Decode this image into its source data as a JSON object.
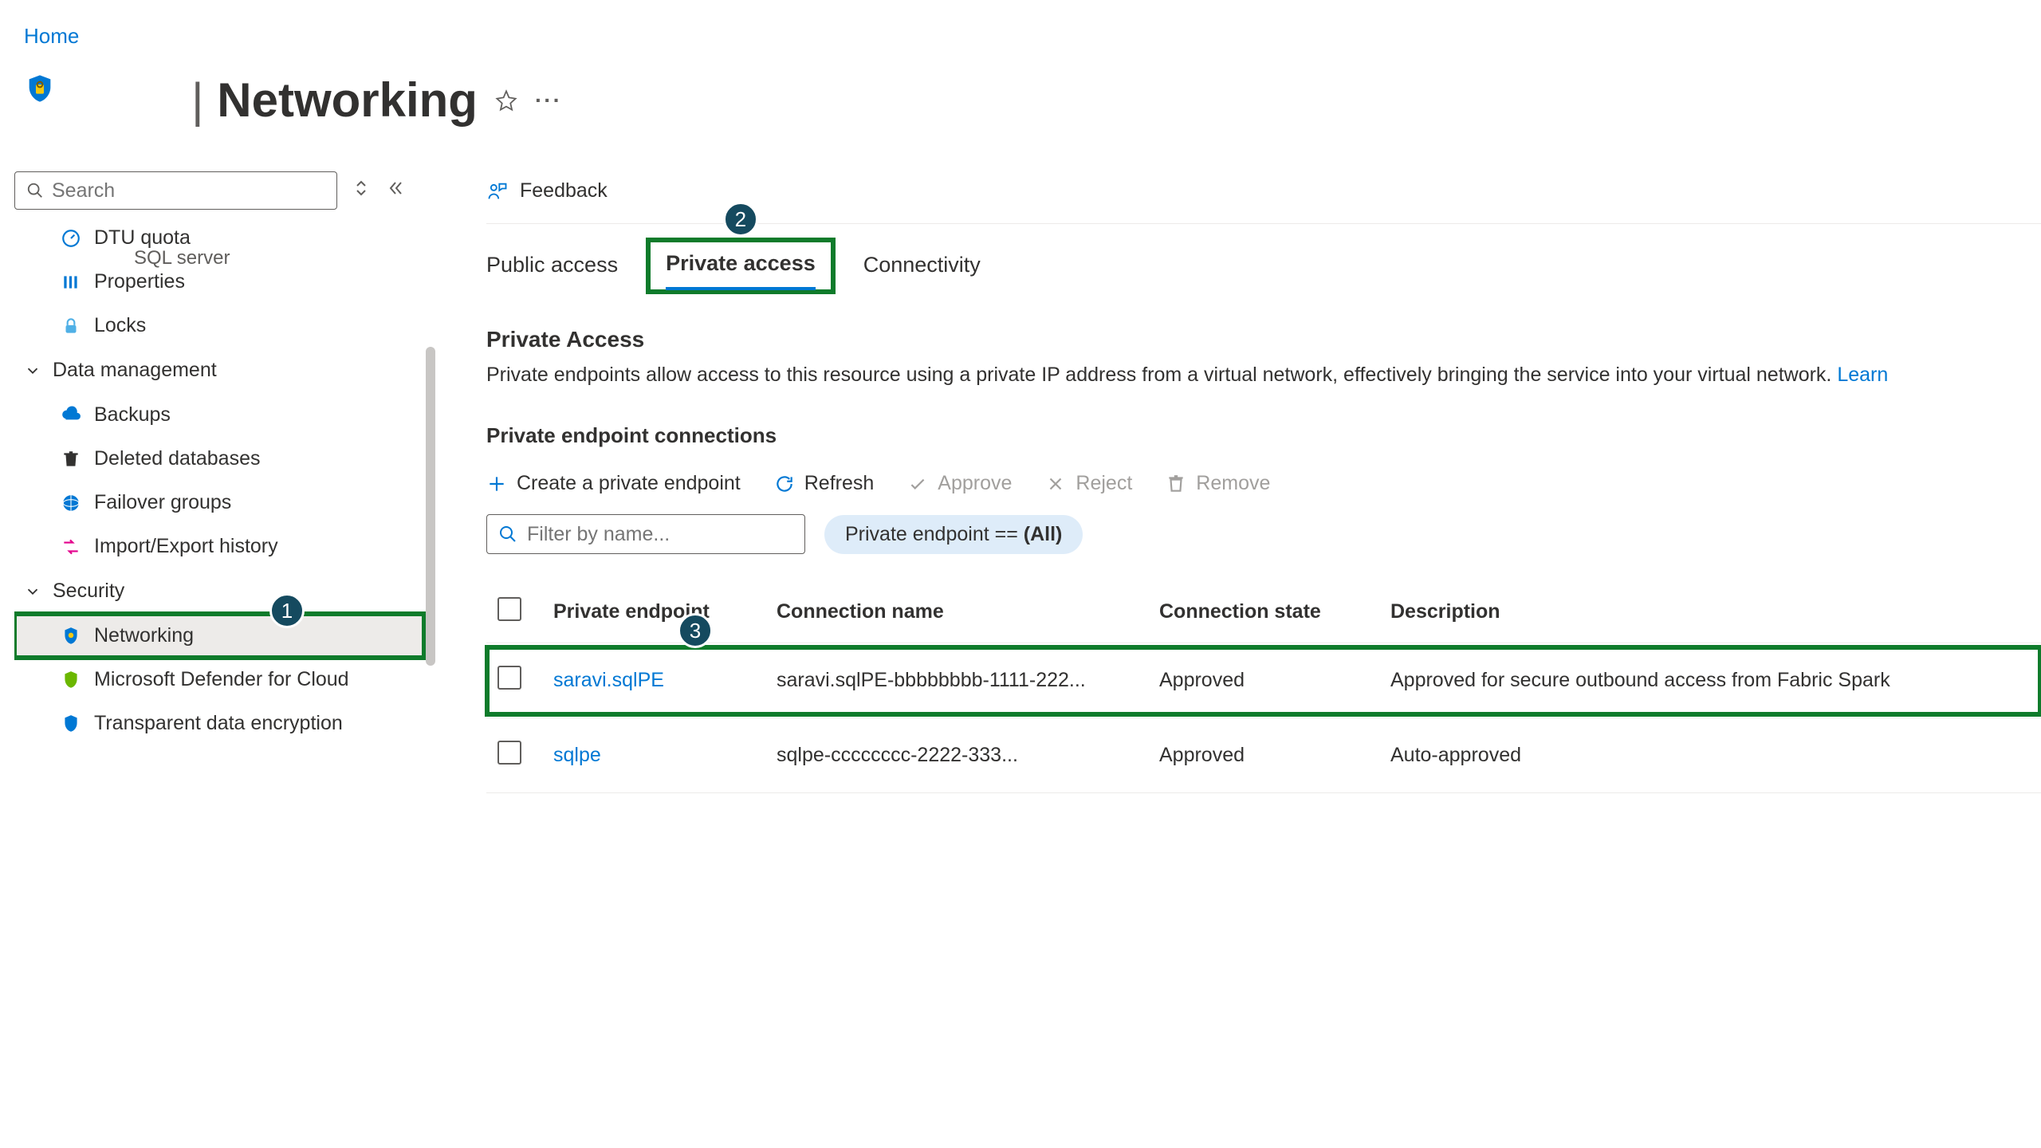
{
  "breadcrumb": {
    "home": "Home"
  },
  "header": {
    "separator": "|",
    "title": "Networking",
    "subtitle": "SQL server"
  },
  "search": {
    "placeholder": "Search"
  },
  "sidebar": {
    "dtu_quota": "DTU quota",
    "properties": "Properties",
    "locks": "Locks",
    "group_data": "Data management",
    "backups": "Backups",
    "deleted_databases": "Deleted databases",
    "failover_groups": "Failover groups",
    "import_export": "Import/Export history",
    "group_security": "Security",
    "networking": "Networking",
    "defender": "Microsoft Defender for Cloud",
    "tde": "Transparent data encryption"
  },
  "feedback": "Feedback",
  "tabs": {
    "public": "Public access",
    "private": "Private access",
    "connectivity": "Connectivity"
  },
  "private_access": {
    "heading": "Private Access",
    "description_prefix": "Private endpoints allow access to this resource using a private IP address from a virtual network, effectively bringing the service into your virtual network. ",
    "learn": "Learn"
  },
  "pe_connections": {
    "heading": "Private endpoint connections"
  },
  "toolbar": {
    "create": "Create a private endpoint",
    "refresh": "Refresh",
    "approve": "Approve",
    "reject": "Reject",
    "remove": "Remove"
  },
  "filter": {
    "placeholder": "Filter by name...",
    "pill_prefix": "Private endpoint == ",
    "pill_value": "(All)"
  },
  "table": {
    "headers": {
      "pe": "Private endpoint",
      "conn": "Connection name",
      "state": "Connection state",
      "desc": "Description"
    },
    "rows": [
      {
        "pe": "saravi.sqlPE",
        "conn": "saravi.sqlPE-bbbbbbbb-1111-222...",
        "state": "Approved",
        "desc": "Approved for secure outbound access from Fabric Spark"
      },
      {
        "pe": "sqlpe",
        "conn": "sqlpe-cccccccc-2222-333...",
        "state": "Approved",
        "desc": "Auto-approved"
      }
    ]
  },
  "badges": {
    "b1": "1",
    "b2": "2",
    "b3": "3"
  }
}
